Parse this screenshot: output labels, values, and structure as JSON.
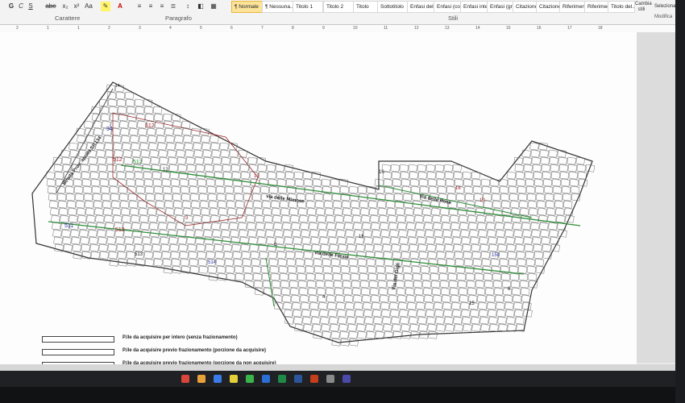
{
  "ribbon": {
    "font_buttons": [
      "G",
      "C",
      "S",
      "abe",
      "x₂",
      "x²",
      "Aa"
    ],
    "group_carattere": "Carattere",
    "group_paragrafo": "Paragrafo",
    "group_stili": "Stili",
    "styles": [
      "¶ Normale",
      "¶ Nessuna...",
      "Titolo 1",
      "Titolo 2",
      "Titolo",
      "Sottotitolo",
      "Enfasi deli...",
      "Enfasi (cor...",
      "Enfasi inte...",
      "Enfasi (gr...",
      "Citazione",
      "Citazione...",
      "Riferiment...",
      "Riferiment...",
      "Titolo del..."
    ],
    "cambia_stili": "Cambia stili",
    "seleziona": "Seleziona",
    "modifica": "Modifica"
  },
  "ruler": {
    "numbers": [
      "2",
      "1",
      "1",
      "2",
      "3",
      "4",
      "5",
      "6",
      "7",
      "8",
      "9",
      "10",
      "11",
      "12",
      "13",
      "14",
      "15",
      "16",
      "17",
      "18"
    ]
  },
  "map": {
    "roads": [
      "Strada Prov. aprilia SP.134",
      "via delle Mimose",
      "via delle Fresie",
      "Via delle Rose",
      "Via dei Gigli"
    ],
    "parcel_numbers": [
      "14",
      "34",
      "512",
      "512",
      "512",
      "513",
      "511",
      "513",
      "514",
      "12",
      "13",
      "16",
      "16",
      "10",
      "158",
      "16",
      "15",
      "4",
      "3",
      "6",
      "8"
    ]
  },
  "legend": {
    "items": [
      "P.lle da acquisire per intero (senza frazionamento)",
      "P.lle da acquisire previo frazionamento (porzione da acquisire)",
      "P.lle da acquisire previo frazionamento (porzione da non acquisire)"
    ]
  },
  "colors": {
    "accent_style": "#fce39a",
    "road_red": "#a0262a",
    "road_green": "#2f8f3a",
    "parcel_blue": "#2b2f9a"
  }
}
